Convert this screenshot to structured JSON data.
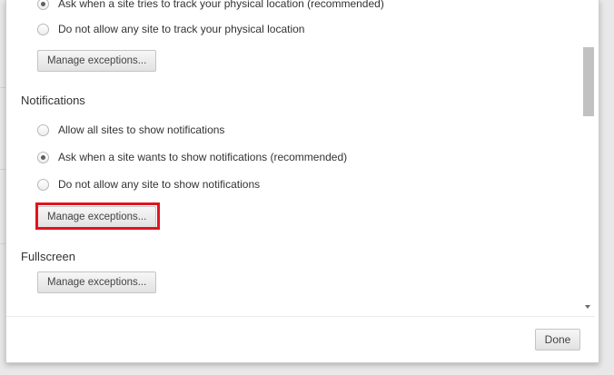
{
  "location": {
    "options": [
      {
        "label": "Ask when a site tries to track your physical location (recommended)",
        "checked": true
      },
      {
        "label": "Do not allow any site to track your physical location",
        "checked": false
      }
    ],
    "manage_label": "Manage exceptions..."
  },
  "notifications": {
    "title": "Notifications",
    "options": [
      {
        "label": "Allow all sites to show notifications",
        "checked": false
      },
      {
        "label": "Ask when a site wants to show notifications (recommended)",
        "checked": true
      },
      {
        "label": "Do not allow any site to show notifications",
        "checked": false
      }
    ],
    "manage_label": "Manage exceptions...",
    "highlight_color": "#e0141e"
  },
  "fullscreen": {
    "title": "Fullscreen",
    "manage_label": "Manage exceptions..."
  },
  "footer": {
    "done_label": "Done"
  }
}
